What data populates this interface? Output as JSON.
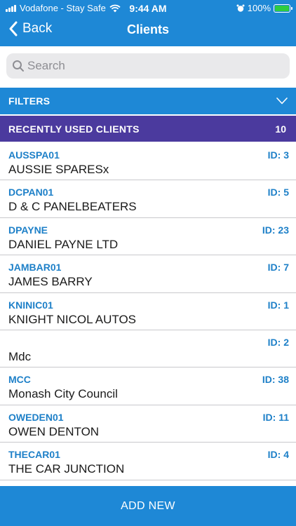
{
  "status_bar": {
    "carrier": "Vodafone - Stay Safe",
    "time": "9:44 AM",
    "battery": "100%"
  },
  "nav": {
    "back_label": "Back",
    "title": "Clients"
  },
  "search": {
    "placeholder": "Search",
    "value": ""
  },
  "filters": {
    "label": "FILTERS"
  },
  "recent": {
    "label": "RECENTLY USED CLIENTS",
    "count": "10"
  },
  "clients": [
    {
      "code": "AUSSPA01",
      "id": "ID: 3",
      "name": "AUSSIE SPARESx"
    },
    {
      "code": "DCPAN01",
      "id": "ID: 5",
      "name": "D & C PANELBEATERS"
    },
    {
      "code": "DPAYNE",
      "id": "ID: 23",
      "name": "DANIEL PAYNE LTD"
    },
    {
      "code": "JAMBAR01",
      "id": "ID: 7",
      "name": "JAMES BARRY"
    },
    {
      "code": "KNINIC01",
      "id": "ID: 1",
      "name": "KNIGHT NICOL AUTOS"
    },
    {
      "code": "",
      "id": "ID: 2",
      "name": "Mdc"
    },
    {
      "code": "MCC",
      "id": "ID: 38",
      "name": "Monash City Council"
    },
    {
      "code": "OWEDEN01",
      "id": "ID: 11",
      "name": "OWEN DENTON"
    },
    {
      "code": "THECAR01",
      "id": "ID: 4",
      "name": "THE CAR JUNCTION"
    }
  ],
  "footer": {
    "add_new_label": "ADD NEW"
  },
  "colors": {
    "header": "#1e88d6",
    "recent_bar": "#4b3a9e",
    "link_blue": "#1e80c8",
    "battery": "#2ecc40"
  }
}
